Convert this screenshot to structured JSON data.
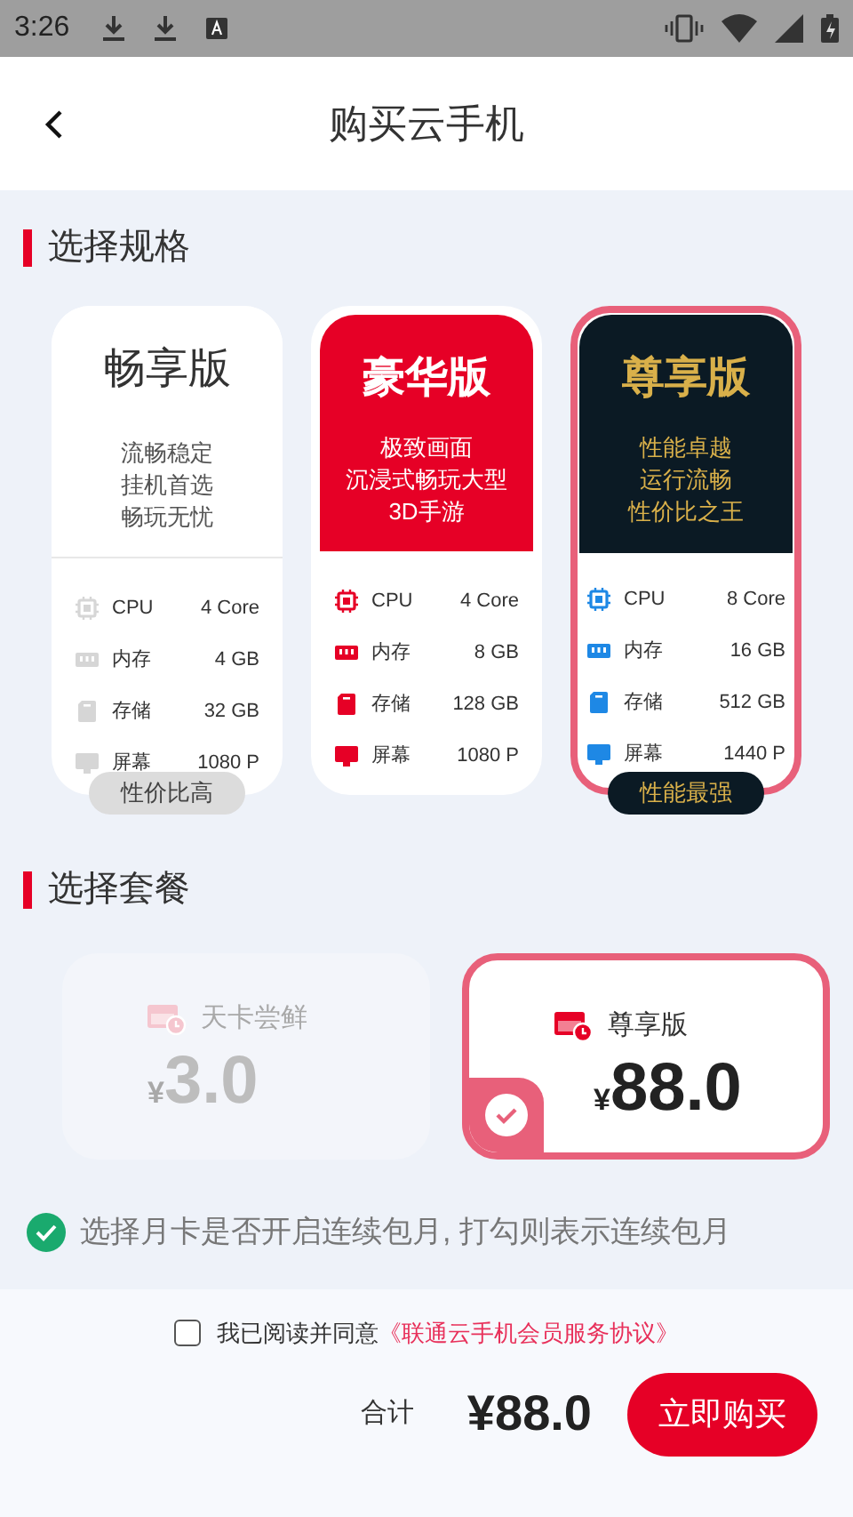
{
  "status_bar": {
    "time": "3:26"
  },
  "header": {
    "title": "购买云手机"
  },
  "spec_section": {
    "title": "选择规格"
  },
  "tiers": [
    {
      "kind": "plain",
      "name": "畅享版",
      "lines": [
        "流畅稳定",
        "挂机首选",
        "畅玩无忧"
      ],
      "selected": false,
      "badge": "性价比高",
      "specs": [
        {
          "kind": "cpu",
          "label": "CPU",
          "value": "4 Core"
        },
        {
          "kind": "memory",
          "label": "内存",
          "value": "4 GB"
        },
        {
          "kind": "storage",
          "label": "存储",
          "value": "32 GB"
        },
        {
          "kind": "screen",
          "label": "屏幕",
          "value": "1080 P"
        }
      ]
    },
    {
      "kind": "red",
      "name": "豪华版",
      "lines": [
        "极致画面",
        "沉浸式畅玩大型",
        "3D手游"
      ],
      "selected": false,
      "specs": [
        {
          "kind": "cpu",
          "label": "CPU",
          "value": "4 Core"
        },
        {
          "kind": "memory",
          "label": "内存",
          "value": "8 GB"
        },
        {
          "kind": "storage",
          "label": "存储",
          "value": "128 GB"
        },
        {
          "kind": "screen",
          "label": "屏幕",
          "value": "1080 P"
        }
      ]
    },
    {
      "kind": "dark",
      "name": "尊享版",
      "lines": [
        "性能卓越",
        "运行流畅",
        "性价比之王"
      ],
      "selected": true,
      "badge": "性能最强",
      "specs": [
        {
          "kind": "cpu",
          "label": "CPU",
          "value": "8 Core"
        },
        {
          "kind": "memory",
          "label": "内存",
          "value": "16 GB"
        },
        {
          "kind": "storage",
          "label": "存储",
          "value": "512 GB"
        },
        {
          "kind": "screen",
          "label": "屏幕",
          "value": "1440 P"
        }
      ]
    }
  ],
  "plan_section": {
    "title": "选择套餐"
  },
  "plans": [
    {
      "name": "天卡尝鲜",
      "currency": "¥",
      "price": "3.0",
      "selected": false,
      "disabled": true
    },
    {
      "name": "尊享版",
      "currency": "¥",
      "price": "88.0",
      "selected": true,
      "disabled": false
    }
  ],
  "auto_renew": {
    "checked": true,
    "text": "选择月卡是否开启连续包月, 打勾则表示连续包月"
  },
  "agreement": {
    "checked": false,
    "text": "我已阅读并同意",
    "link": "《联通云手机会员服务协议》"
  },
  "total": {
    "label": "合计",
    "value": "¥88.0"
  },
  "buy_button": "立即购买"
}
